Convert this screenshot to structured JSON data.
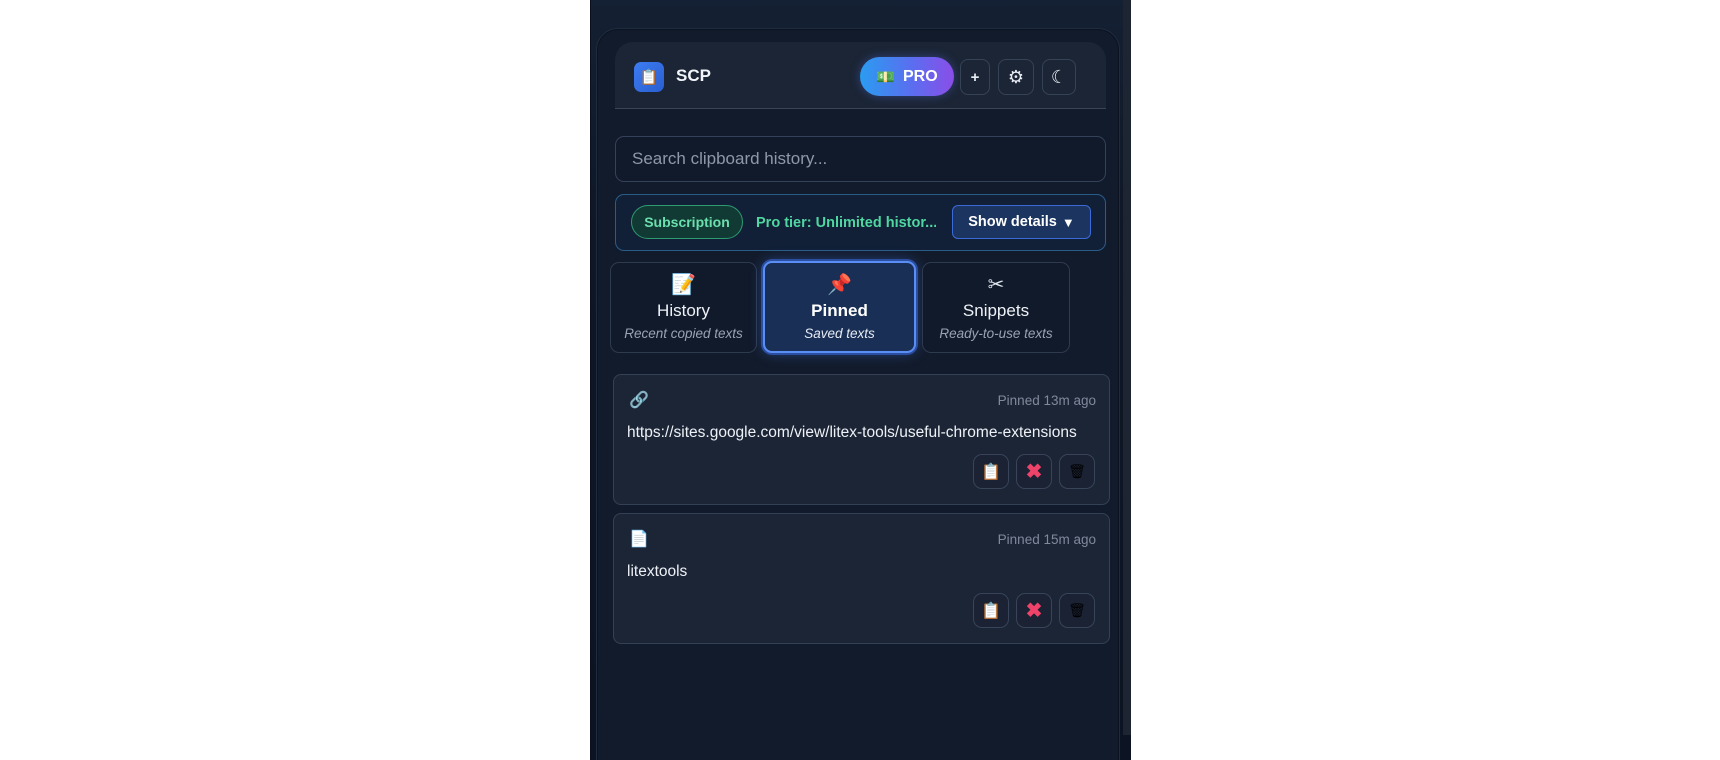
{
  "app": {
    "title": "SCP",
    "logo_icon": "clipboard-icon"
  },
  "header": {
    "pro_label": "PRO",
    "pro_icon": "money-icon",
    "add_symbol": "+",
    "settings_symbol": "⚙",
    "theme_symbol": "☾"
  },
  "search": {
    "placeholder": "Search clipboard history..."
  },
  "subscription": {
    "badge": "Subscription",
    "text": "Pro tier: Unlimited histor...",
    "details_label": "Show details",
    "details_arrow": "▼"
  },
  "tabs": [
    {
      "icon": "📝",
      "label": "History",
      "desc": "Recent copied texts"
    },
    {
      "icon": "📌",
      "label": "Pinned",
      "desc": "Saved texts"
    },
    {
      "icon": "✂",
      "label": "Snippets",
      "desc": "Ready-to-use texts"
    }
  ],
  "items": [
    {
      "icon": "🔗",
      "time": "Pinned 13m ago",
      "text": "https://sites.google.com/view/litex-tools/useful-chrome-extensions"
    },
    {
      "icon": "📄",
      "time": "Pinned 15m ago",
      "text": "litextools"
    }
  ],
  "item_actions": {
    "copy": "📋",
    "unpin": "✖",
    "delete": "🗑"
  },
  "colors": {
    "accent": "#5b8ef5",
    "success": "#4fd6a1",
    "danger": "#f0436a"
  }
}
